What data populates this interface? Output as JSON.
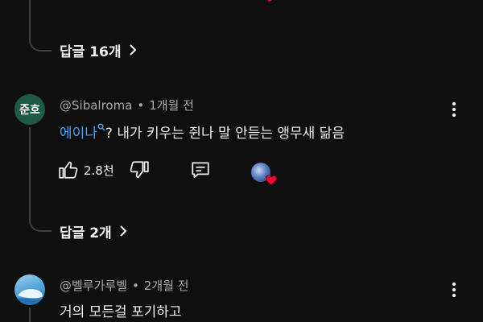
{
  "colors": {
    "background": "#0f0f0f",
    "text": "#f1f1f1",
    "meta": "#aaaaaa",
    "mention": "#3ea6ff",
    "heart": "#ff0033"
  },
  "comments": [
    {
      "replies_label": "답글 16개"
    },
    {
      "avatar_text": "준호",
      "author": "@Sibalroma",
      "time": "1개월 전",
      "mention": "에이나",
      "body": "? 내가 키우는 쥔나 말 안듣는 앵무새 닮음",
      "likes": "2.8천",
      "replies_label": "답글 2개",
      "creator_hearted": true
    },
    {
      "author": "@벨루가루벨",
      "time": "2개월 전",
      "body": "거의 모든걸 포기하고"
    }
  ]
}
